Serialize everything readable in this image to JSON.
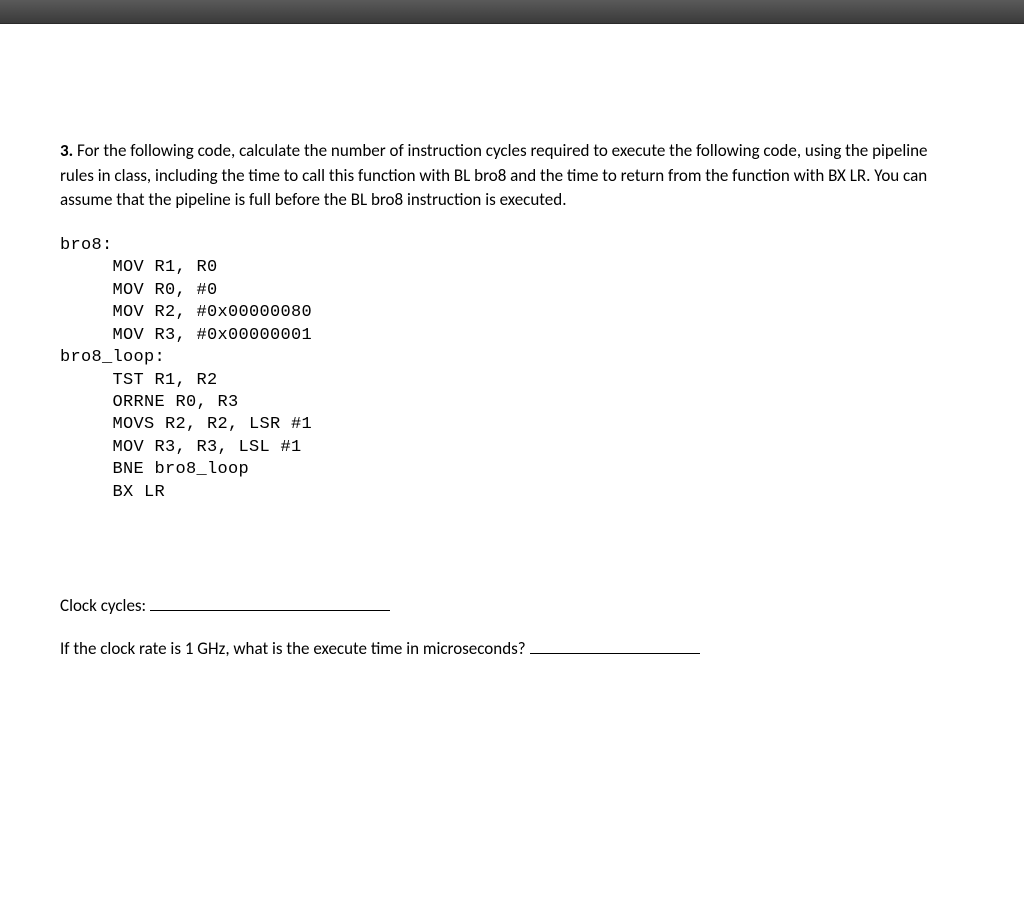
{
  "question": {
    "number": "3.",
    "prompt1": " For the following code, calculate the number of instruction cycles required to execute the following code, using the pipeline rules in class, including the time to call this function with BL bro8 and the time to return from the function with BX LR.  You can assume that the pipeline is full before the BL bro8 instruction is executed."
  },
  "code": "bro8:\n     MOV R1, R0\n     MOV R0, #0\n     MOV R2, #0x00000080\n     MOV R3, #0x00000001\nbro8_loop:\n     TST R1, R2\n     ORRNE R0, R3\n     MOVS R2, R2, LSR #1\n     MOV R3, R3, LSL #1\n     BNE bro8_loop\n     BX LR",
  "answers": {
    "cycles_label": "Clock cycles:",
    "exec_label": "If the clock rate is 1 GHz, what is the execute time in microseconds?"
  }
}
